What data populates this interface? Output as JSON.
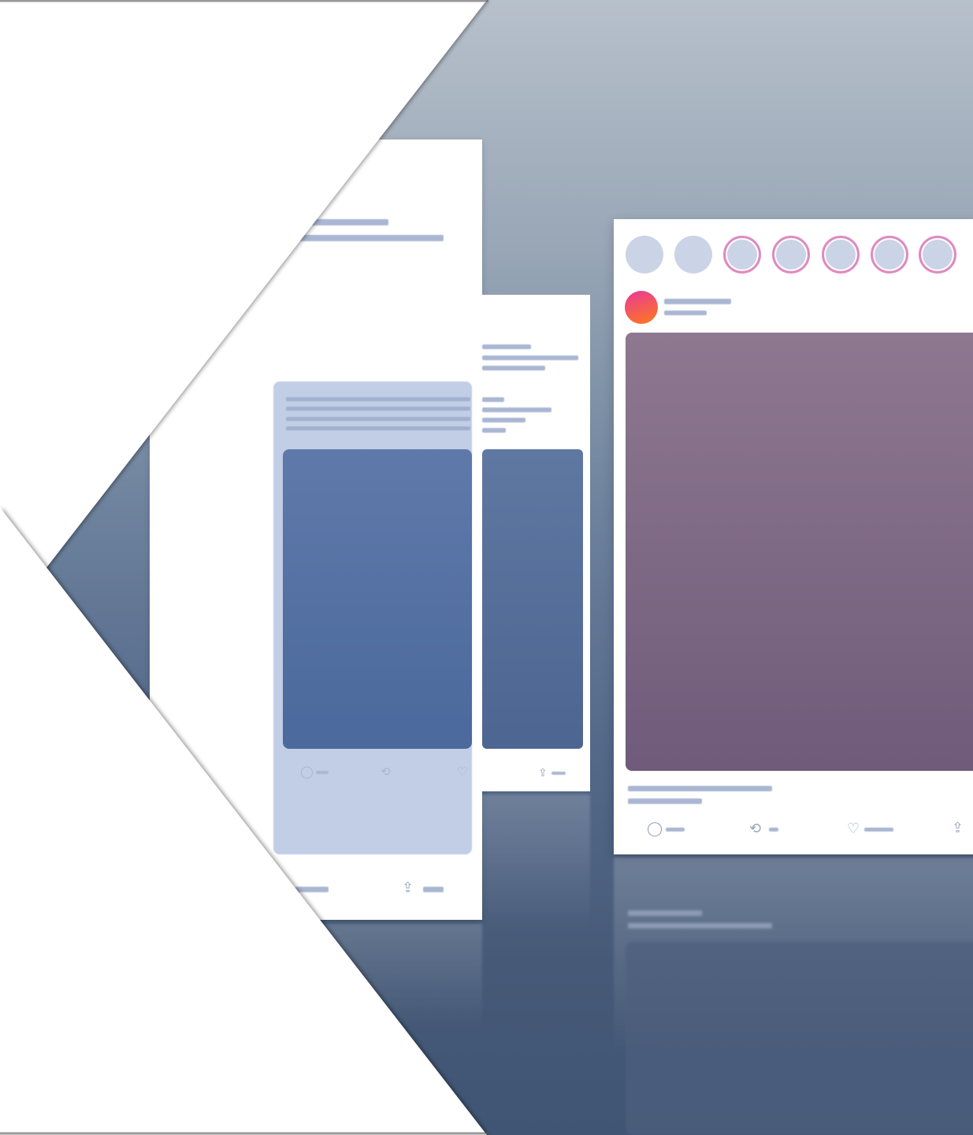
{
  "colors": {
    "background_top": "#b7c0cb",
    "background_bottom": "#3f5573",
    "card": "#ffffff",
    "placeholder_bar": "#aab7d3",
    "media_blue": "#5f79aa",
    "media_purple": "#8e7890",
    "story_ring": "#e08ac0",
    "avatar_gradient_start": "#e8389a",
    "avatar_gradient_end": "#ff7a1a"
  },
  "icons": {
    "comment": "comment-icon",
    "repost": "repost-icon",
    "like": "heart-icon",
    "share": "share-icon"
  },
  "front_card": {
    "stories": [
      "plain",
      "plain",
      "ring",
      "ring",
      "ring",
      "ring",
      "ring"
    ]
  }
}
